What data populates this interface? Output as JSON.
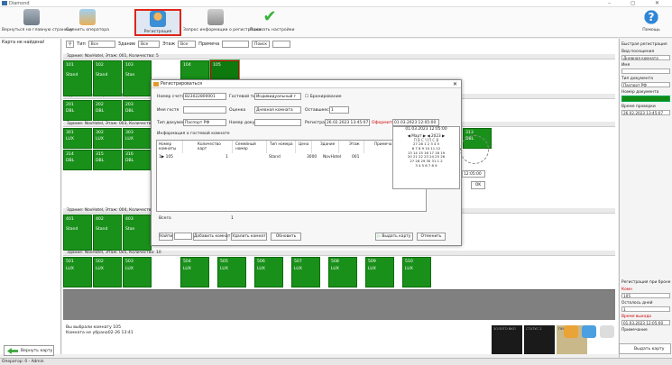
{
  "app": {
    "title": "Diamond",
    "controls": "–  ◻  ✕"
  },
  "toolbar": {
    "home": "Вернуться на главную страницу",
    "change_op": "Сменить оператора",
    "register": "Регистрация",
    "request": "Запрос информации о регистрации",
    "settings": "Показать настройки",
    "help": "Помощь"
  },
  "left": {
    "message": "Карта не найдена!"
  },
  "filters": {
    "type_label": "Тип",
    "type_val": "Все",
    "bldg_label": "Здание",
    "bldg_val": "Все",
    "floor_label": "Этаж",
    "floor_val": "Все",
    "note_label": "Примеча",
    "search": "Поиск"
  },
  "buildings": [
    {
      "header": "Здание: NovHotel, Этаж: 001, Количество: 5",
      "rooms": [
        {
          "n": "101",
          "t": "Stand"
        },
        {
          "n": "102",
          "t": "Stand"
        },
        {
          "n": "103",
          "t": "Stan"
        },
        {
          "n": "104",
          "t": ""
        },
        {
          "n": "105",
          "t": ""
        }
      ]
    },
    {
      "header": "Здание: NovHotel, Этаж: 002, Количество: 9",
      "rooms": [
        {
          "n": "201",
          "t": "DBL"
        },
        {
          "n": "202",
          "t": "DBL"
        },
        {
          "n": "203",
          "t": "DBL"
        }
      ]
    },
    {
      "header": "Здание: NovHotel, Этаж: 003, Количество: 2",
      "rooms": [
        {
          "n": "301",
          "t": "LUX"
        },
        {
          "n": "302",
          "t": "LUX"
        },
        {
          "n": "303",
          "t": "LUX"
        },
        {
          "n": "313",
          "t": "DBL"
        },
        {
          "n": "314",
          "t": "DBL"
        },
        {
          "n": "315",
          "t": "DBL"
        },
        {
          "n": "316",
          "t": "DBL"
        }
      ]
    },
    {
      "header": "Здание: NovHotel, Этаж: 004, Количество: 9",
      "rooms": [
        {
          "n": "401",
          "t": "Stand"
        },
        {
          "n": "402",
          "t": "Stand"
        },
        {
          "n": "403",
          "t": "Stan"
        }
      ]
    },
    {
      "header": "Здание: NovHotel, Этаж: 005, Количество: 10",
      "rooms": [
        {
          "n": "501",
          "t": "LUX"
        },
        {
          "n": "502",
          "t": "LUX"
        },
        {
          "n": "503",
          "t": "LUX"
        },
        {
          "n": "504",
          "t": "LUX"
        },
        {
          "n": "505",
          "t": "LUX"
        },
        {
          "n": "506",
          "t": "LUX"
        },
        {
          "n": "507",
          "t": "LUX"
        },
        {
          "n": "508",
          "t": "LUX"
        },
        {
          "n": "509",
          "t": "LUX"
        },
        {
          "n": "510",
          "t": "LUX"
        }
      ]
    }
  ],
  "bottom": {
    "line1": "Вы выбрали комнату 105",
    "line2": "Комната не убрана02-26 13:41",
    "return_card": "Вернуть карту",
    "give_card": "Выдать карту"
  },
  "status": {
    "text": "Оператор: 0 - Admin"
  },
  "thumbs": [
    "ЗОЛОТО ВКЛ",
    "СТАТУС 2",
    "ПУСТО"
  ],
  "right": {
    "quick_reg": "Быстрая регистрация",
    "stay_type": "Вид посещения",
    "stay_val": "Дневная комната",
    "name": "Имя",
    "doc_type": "Тип документа",
    "doc_val": "Паспорт РФ",
    "doc_num": "Номер документа",
    "check_time": "Время проверки",
    "check_val": "26.02.2023 13:45:07",
    "reg_on": "Регистрация при броне",
    "room_lbl": "Комн",
    "room_val": "105",
    "days_lbl": "Осталось дней",
    "days_val": "1",
    "exit_lbl": "Время выхода",
    "exit_val": "01.03.2023 12:05:00",
    "note": "Примечание"
  },
  "dialog": {
    "title": "Регистрироваться",
    "acct_lbl": "Номер счета",
    "acct_val": "B23022800001",
    "gtype_lbl": "Гостевой тип",
    "gtype_val": "Индивидуальный г",
    "book_lbl": "Бронирование",
    "guest_lbl": "Имя гостя",
    "rate_lbl": "Оценка",
    "rate_val": "Дневная комната",
    "remain_lbl": "Оставшееся",
    "remain_val": "1",
    "doctype_lbl": "Тип документ",
    "doctype_val": "Паспорт РФ",
    "docnum_lbl": "Номер докум",
    "regdt_lbl": "Регистрац",
    "regdt_val": "26.02.2023 13:45:07",
    "checkout_lbl": "Оформить",
    "checkout_val": "01.03.2023 12:05:00",
    "info_lbl": "Информация о гостевой комнате",
    "cols": [
      "Номер комнаты",
      "Количество карт",
      "Семейный номер",
      "Тип номера",
      "Цена",
      "Здание",
      "Этаж",
      "Примеча"
    ],
    "row": {
      "room": "1▶ 105",
      "cards": "1",
      "type": "Stand",
      "price": "3000",
      "bldg": "NovHotel",
      "floor": "001"
    },
    "total_lbl": "Всего",
    "total_val": "1",
    "find": "Найти",
    "add_room": "Добавить комнат",
    "delete_room": "Удалить комнат",
    "refresh": "Обновить",
    "give": "Выдать карту",
    "cancel": "Отменить",
    "cal_header": "01.03.2023 12:05:00",
    "cal_month": "◀ Март ▶  ◀ 2023 ▶",
    "cal_days": "П В С Ч П С В",
    "cal_rows": [
      "27 28  1  2  3  4  5",
      "6  7  8  9 10 11 12",
      "13 14 15 16 17 18 19",
      "20 21 22 23 24 25 26",
      "27 28 29 30 31  1  2",
      "3  4  5  6  7  8  9"
    ],
    "cal_time": "12:05:00",
    "cal_ok": "OK"
  }
}
